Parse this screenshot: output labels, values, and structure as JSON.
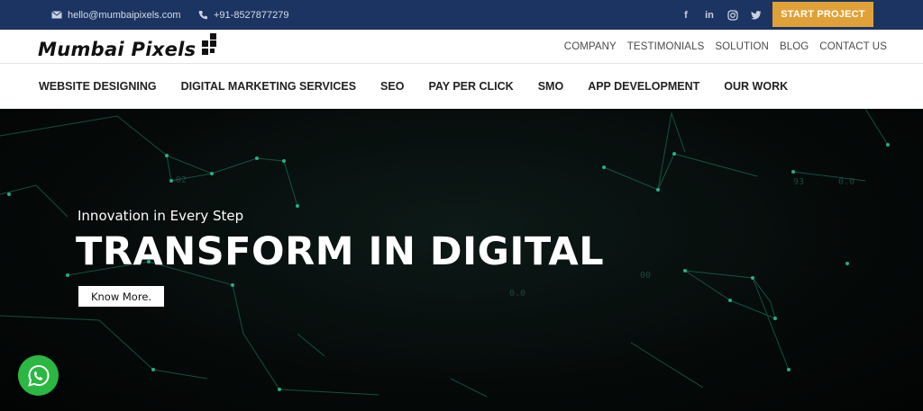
{
  "topbar": {
    "email": "hello@mumbaipixels.com",
    "phone": "+91-8527877279",
    "socials": [
      {
        "icon": "facebook-icon",
        "glyph": "f"
      },
      {
        "icon": "linkedin-icon",
        "glyph": "in"
      },
      {
        "icon": "instagram-icon",
        "glyph": ""
      },
      {
        "icon": "twitter-icon",
        "glyph": ""
      }
    ],
    "cta_label": "START PROJECT"
  },
  "header": {
    "logo_text": "Mumbai Pixels",
    "links": [
      "COMPANY",
      "TESTIMONIALS",
      "SOLUTION",
      "BLOG",
      "CONTACT US"
    ]
  },
  "nav": {
    "items": [
      "WEBSITE DESIGNING",
      "DIGITAL MARKETING SERVICES",
      "SEO",
      "PAY PER CLICK",
      "SMO",
      "APP DEVELOPMENT",
      "OUR WORK"
    ]
  },
  "hero": {
    "subtitle": "Innovation in Every Step",
    "title": "TRANSFORM IN DIGITAL",
    "button_label": "Know More."
  },
  "colors": {
    "topbar_bg": "#1c3461",
    "cta_bg": "#e0a238",
    "whatsapp": "#2bb741",
    "network_line": "#1f8a6a"
  }
}
